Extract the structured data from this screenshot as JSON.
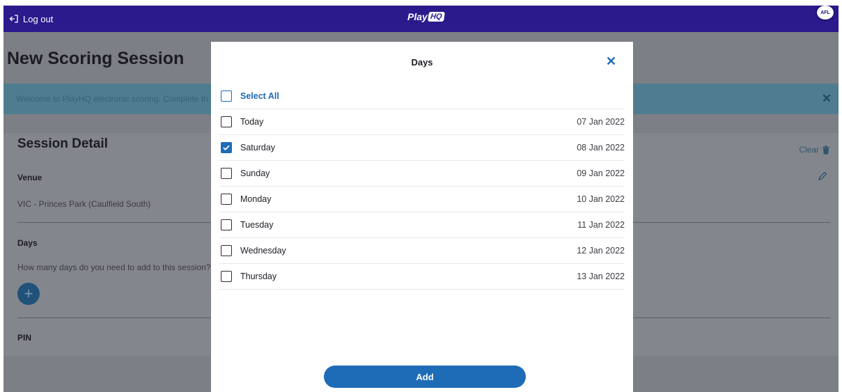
{
  "header": {
    "logout_label": "Log out",
    "brand_text": "Play",
    "brand_badge": "HQ",
    "partner_logo_text": "AFL"
  },
  "page": {
    "title": "New Scoring Session",
    "banner_text": "Welcome to PlayHQ electronic scoring. Complete th",
    "session_detail_title": "Session Detail",
    "clear_label": "Clear",
    "venue_label": "Venue",
    "venue_value": "VIC - Princes Park (Caulfield South)",
    "days_label": "Days",
    "days_question": "How many days do you need to add to this session?",
    "pin_label": "PIN"
  },
  "modal": {
    "title": "Days",
    "select_all_label": "Select All",
    "days": [
      {
        "name": "Today",
        "date": "07 Jan 2022",
        "checked": false
      },
      {
        "name": "Saturday",
        "date": "08 Jan 2022",
        "checked": true
      },
      {
        "name": "Sunday",
        "date": "09 Jan 2022",
        "checked": false
      },
      {
        "name": "Monday",
        "date": "10 Jan 2022",
        "checked": false
      },
      {
        "name": "Tuesday",
        "date": "11 Jan 2022",
        "checked": false
      },
      {
        "name": "Wednesday",
        "date": "12 Jan 2022",
        "checked": false
      },
      {
        "name": "Thursday",
        "date": "13 Jan 2022",
        "checked": false
      }
    ],
    "add_label": "Add"
  },
  "colors": {
    "topbar": "#2a1a8c",
    "accent": "#1e6bb8",
    "overlay": "#7c7f85"
  },
  "icons": {
    "logout": "logout-icon",
    "close": "close-icon",
    "trash": "trash-icon",
    "edit": "pencil-icon",
    "add": "plus-icon",
    "check": "checkmark-icon"
  }
}
